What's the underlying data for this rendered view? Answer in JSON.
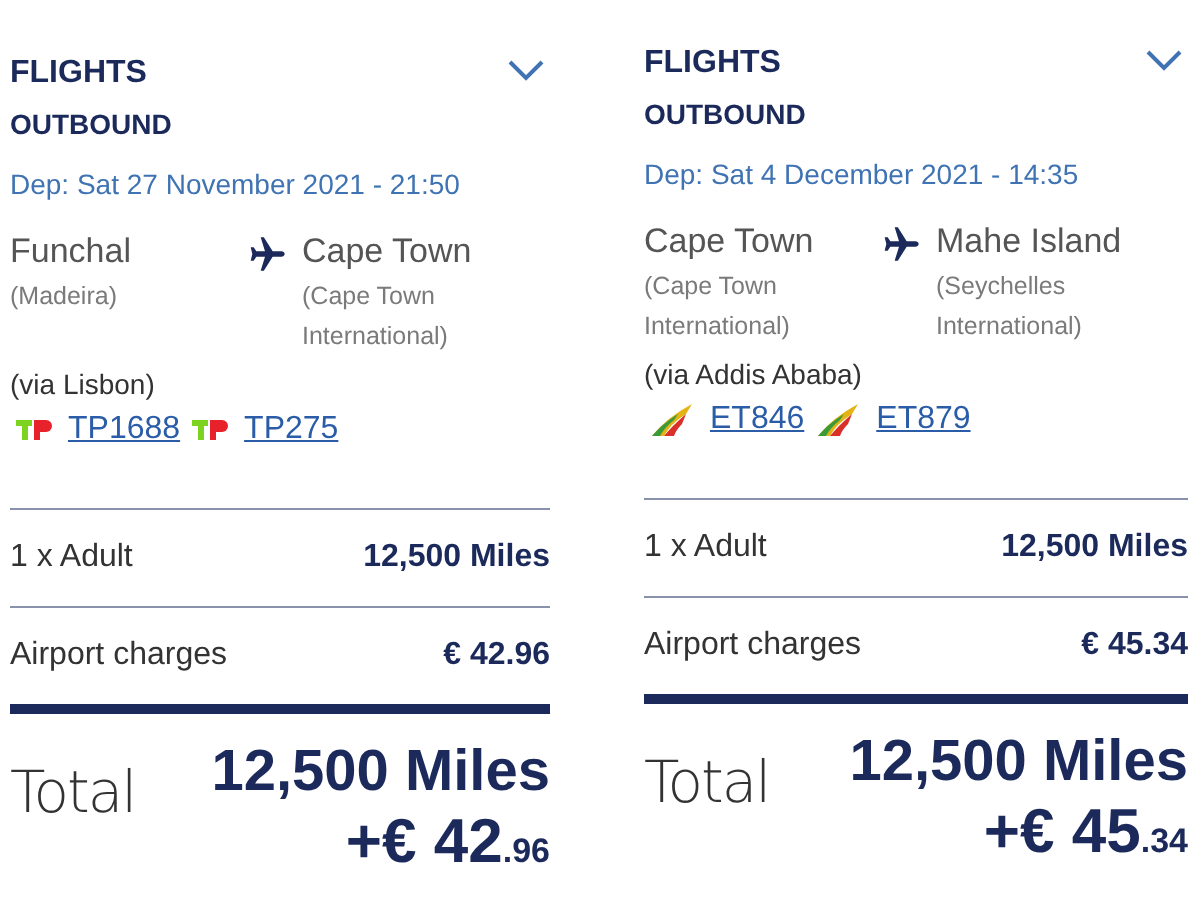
{
  "itineraries": [
    {
      "heading": "FLIGHTS",
      "subheading": "OUTBOUND",
      "departure": "Dep: Sat 27 November 2021 - 21:50",
      "origin": {
        "city": "Funchal",
        "airport": "(Madeira)"
      },
      "destination": {
        "city": "Cape Town",
        "airport": "(Cape Town International)"
      },
      "via": "(via Lisbon)",
      "flights": [
        {
          "kind": "tap",
          "code": "TP1688"
        },
        {
          "kind": "tap",
          "code": "TP275"
        }
      ],
      "lines": [
        {
          "label": "1 x Adult",
          "amount": "12,500 Miles"
        },
        {
          "label": "Airport charges",
          "amount": "€ 42.96"
        }
      ],
      "total": {
        "label": "Total",
        "miles": "12,500 Miles",
        "cash": "+€ 42",
        "cents": ".96"
      }
    },
    {
      "heading": "FLIGHTS",
      "subheading": "OUTBOUND",
      "departure": "Dep: Sat 4 December 2021 - 14:35",
      "origin": {
        "city": "Cape Town",
        "airport": "(Cape Town International)"
      },
      "destination": {
        "city": "Mahe Island",
        "airport": "(Seychelles International)"
      },
      "via": "(via Addis Ababa)",
      "flights": [
        {
          "kind": "ethiopian",
          "code": "ET846"
        },
        {
          "kind": "ethiopian",
          "code": "ET879"
        }
      ],
      "lines": [
        {
          "label": "1 x Adult",
          "amount": "12,500 Miles"
        },
        {
          "label": "Airport charges",
          "amount": "€ 45.34"
        }
      ],
      "total": {
        "label": "Total",
        "miles": "12,500 Miles",
        "cash": "+€ 45",
        "cents": ".34"
      }
    }
  ]
}
